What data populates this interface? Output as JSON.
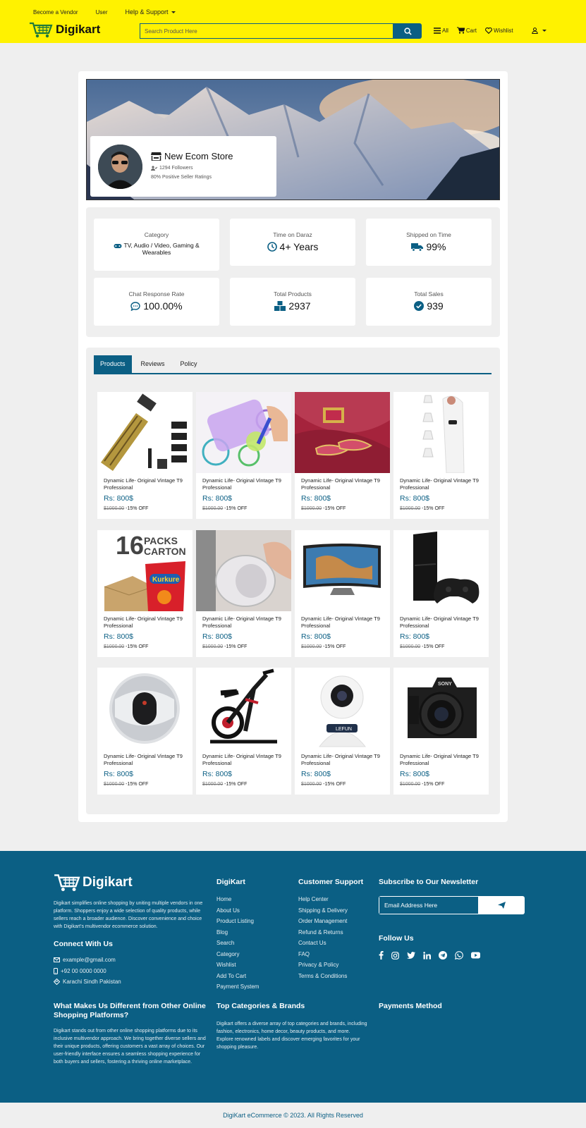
{
  "header": {
    "top_links": [
      "Become a Vendor",
      "User",
      "Help & Support"
    ],
    "brand": "Digikart",
    "search_placeholder": "Search Product Here",
    "nav": [
      "All",
      "Cart",
      "Wishlist"
    ]
  },
  "store": {
    "name": "New Ecom Store",
    "followers": "1294 Followers",
    "rating": "80% Positive Seller Ratings"
  },
  "stats": [
    {
      "label": "Category",
      "value": "TV, Audio / Video, Gaming & Wearables",
      "icon": "gamepad-icon"
    },
    {
      "label": "Time on Daraz",
      "value": "4+ Years",
      "icon": "clock-icon"
    },
    {
      "label": "Shipped on Time",
      "value": "99%",
      "icon": "truck-icon"
    },
    {
      "label": "Chat Response Rate",
      "value": "100.00%",
      "icon": "chat-icon"
    },
    {
      "label": "Total Products",
      "value": "2937",
      "icon": "boxes-icon"
    },
    {
      "label": "Total Sales",
      "value": "939",
      "icon": "check-circle-icon"
    }
  ],
  "tabs": [
    "Products",
    "Reviews",
    "Policy"
  ],
  "products": [
    {
      "title": "Dynamic Life- Original Vintage T9 Professional",
      "price": "Rs: 800$",
      "old_price": "$1000.00",
      "discount": "-15% OFF",
      "image": "trimmer"
    },
    {
      "title": "Dynamic Life- Original Vintage T9 Professional",
      "price": "Rs: 800$",
      "old_price": "$1000.00",
      "discount": "-15% OFF",
      "image": "spirograph"
    },
    {
      "title": "Dynamic Life- Original Vintage T9 Professional",
      "price": "Rs: 800$",
      "old_price": "$1000.00",
      "discount": "-15% OFF",
      "image": "shoes"
    },
    {
      "title": "Dynamic Life- Original Vintage T9 Professional",
      "price": "Rs: 800$",
      "old_price": "$1000.00",
      "discount": "-15% OFF",
      "image": "blackhead-remover"
    },
    {
      "title": "Dynamic Life- Original Vintage T9 Professional",
      "price": "Rs: 800$",
      "old_price": "$1000.00",
      "discount": "-15% OFF",
      "image": "kurkure",
      "img_text": [
        "16",
        "PACKS",
        "CARTON",
        "Kurkure"
      ]
    },
    {
      "title": "Dynamic Life- Original Vintage T9 Professional",
      "price": "Rs: 800$",
      "old_price": "$1000.00",
      "discount": "-15% OFF",
      "image": "tape"
    },
    {
      "title": "Dynamic Life- Original Vintage T9 Professional",
      "price": "Rs: 800$",
      "old_price": "$1000.00",
      "discount": "-15% OFF",
      "image": "tv"
    },
    {
      "title": "Dynamic Life- Original Vintage T9 Professional",
      "price": "Rs: 800$",
      "old_price": "$1000.00",
      "discount": "-15% OFF",
      "image": "ps4"
    },
    {
      "title": "Dynamic Life- Original Vintage T9 Professional",
      "price": "Rs: 800$",
      "old_price": "$1000.00",
      "discount": "-15% OFF",
      "image": "camera360"
    },
    {
      "title": "Dynamic Life- Original Vintage T9 Professional",
      "price": "Rs: 800$",
      "old_price": "$1000.00",
      "discount": "-15% OFF",
      "image": "bike"
    },
    {
      "title": "Dynamic Life- Original Vintage T9 Professional",
      "price": "Rs: 800$",
      "old_price": "$1000.00",
      "discount": "-15% OFF",
      "image": "cctv",
      "img_text": [
        "LEFUN"
      ]
    },
    {
      "title": "Dynamic Life- Original Vintage T9 Professional",
      "price": "Rs: 800$",
      "old_price": "$1000.00",
      "discount": "-15% OFF",
      "image": "dslr",
      "img_text": [
        "SONY"
      ]
    }
  ],
  "footer": {
    "brand": "Digikart",
    "about": "Digikart simplifies online shopping by uniting multiple vendors in one platform. Shoppers enjoy a wide selection of quality products, while sellers reach a broader audience. Discover convenience and choice with Digikart's multivendor ecommerce solution.",
    "connect_title": "Connect With Us",
    "email": "example@gmail.com",
    "phone": "+92 00 0000 0000",
    "address": "Karachi Sindh Pakistan",
    "digikart_title": "DigiKart",
    "digikart_links": [
      "Home",
      "About Us",
      "Product Listing",
      "Blog",
      "Search",
      "Category",
      "Wishlist",
      "Add To Cart",
      "Payment System"
    ],
    "support_title": "Customer Support",
    "support_links": [
      "Help Center",
      "Shipping & Delivery",
      "Order Management",
      "Refund & Returns",
      "Contact Us",
      "FAQ",
      "Privacy & Policy",
      "Terms & Conditions"
    ],
    "newsletter_title": "Subscribe to Our Newsletter",
    "email_placeholder": "Email Address Here",
    "follow_title": "Follow Us",
    "social": [
      "facebook-icon",
      "instagram-icon",
      "twitter-icon",
      "linkedin-icon",
      "telegram-icon",
      "whatsapp-icon",
      "youtube-icon"
    ],
    "diff_title": "What Makes Us Different from Other Online Shopping Platforms?",
    "diff_text": "Digikart stands out from other online shopping platforms due to its inclusive multivendor approach. We bring together diverse sellers and their unique products, offering customers a vast array of choices. Our user-friendly interface ensures a seamless shopping experience for both buyers and sellers, fostering a thriving online marketplace.",
    "cats_title": "Top Categories & Brands",
    "cats_text": "Digikart offers a diverse array of top categories and brands, including fashion, electronics, home decor, beauty products, and more. Explore renowned labels and discover emerging favorites for your shopping pleasure.",
    "payments_title": "Payments Method",
    "copyright": "DigiKart eCommerce © 2023. All Rights Reserved"
  },
  "colors": {
    "header_bg": "#fff200",
    "brand_blue": "#0b5f84",
    "page_bg": "#efefef"
  }
}
